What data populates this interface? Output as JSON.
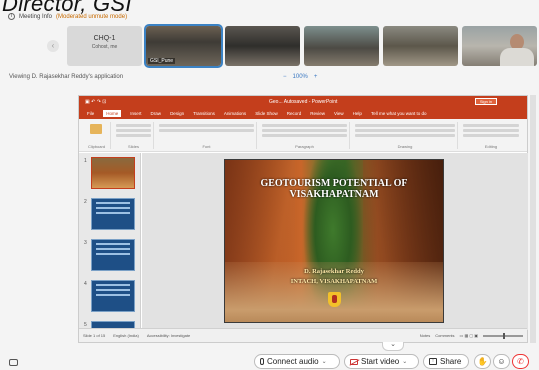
{
  "banner": {
    "text": "Director, GSI"
  },
  "meeting": {
    "info_label": "Meeting Info",
    "mode": "(Moderated unmute mode)"
  },
  "participants": {
    "name_tile": {
      "name": "CHQ-1",
      "sub": "Cohost, me"
    },
    "video_tiles": [
      {
        "caption": "GSI_Pune"
      },
      {
        "caption": ""
      },
      {
        "caption": ""
      },
      {
        "caption": ""
      },
      {
        "caption": ""
      }
    ]
  },
  "share": {
    "viewing_label": "Viewing D. Rajasekhar Reddy's application",
    "zoom_minus": "−",
    "zoom_value": "100%",
    "zoom_plus": "+"
  },
  "powerpoint": {
    "title_bar": "Geo... Autosaved - PowerPoint",
    "sign_in": "Sign in",
    "tabs": [
      "File",
      "Home",
      "Insert",
      "Draw",
      "Design",
      "Transitions",
      "Animations",
      "Slide Show",
      "Record",
      "Review",
      "View",
      "Help",
      "Tell me what you want to do"
    ],
    "ribbon_groups": [
      "Clipboard",
      "Slides",
      "Font",
      "Paragraph",
      "Drawing",
      "Editing"
    ],
    "thumb_numbers": [
      "1",
      "2",
      "3",
      "4",
      "5"
    ],
    "slide": {
      "title": "GEOTOURISM POTENTIAL OF VISAKHAPATNAM",
      "author": "D. Rajasekhar Reddy",
      "org": "INTACH, VISAKHAPATNAM"
    },
    "status": {
      "slide_count": "Slide 1 of 15",
      "language": "English (India)",
      "accessibility": "Accessibility: Investigate",
      "notes": "Notes",
      "comments": "Comments"
    }
  },
  "controls": {
    "collapse": "⌄",
    "audio_label": "Connect audio",
    "video_label": "Start video",
    "share_label": "Share",
    "dropdown": "⌄",
    "hand": "✋",
    "emoji": "☺",
    "leave": "✆"
  },
  "colors": {
    "office_accent": "#c43e1c",
    "active_tile": "#3b82c4",
    "zoom_text": "#3a78c2",
    "leave_red": "#e33"
  }
}
